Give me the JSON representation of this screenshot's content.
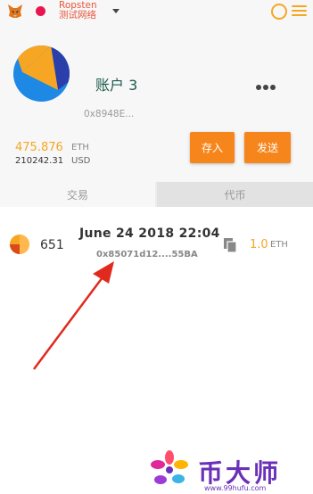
{
  "header": {
    "network_name": "Ropsten",
    "network_subtitle": "测试网络",
    "network_color": "#e91550",
    "logo_icon": "metamask-fox-icon",
    "account_switch_icon": "account-switch-icon",
    "menu_icon": "hamburger-menu-icon"
  },
  "account": {
    "name": "账户 3",
    "address": "0x8948E...",
    "balance_eth": "475.876",
    "balance_eth_unit": "ETH",
    "balance_usd": "210242.31",
    "balance_usd_unit": "USD",
    "more_icon": "more-dots-icon",
    "deposit_label": "存入",
    "send_label": "发送",
    "accent_color": "#f6851b"
  },
  "tabs": {
    "transactions": "交易",
    "tokens": "代币"
  },
  "transactions": [
    {
      "nonce": "651",
      "date": "June 24 2018 22:04",
      "hash": "0x85071d12....55BA",
      "amount": "1.0",
      "unit": "ETH",
      "copy_icon": "copy-icon"
    }
  ],
  "watermark": {
    "title": "币大师",
    "url": "www.99hufu.com"
  }
}
